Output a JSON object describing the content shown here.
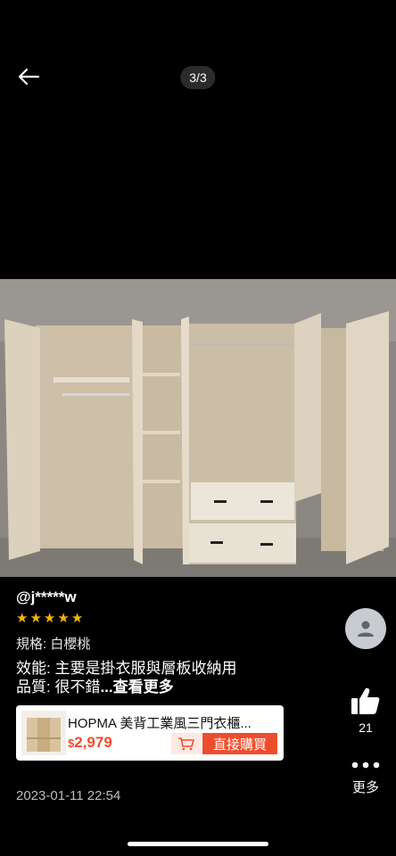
{
  "header": {
    "counter": "3/3"
  },
  "review": {
    "reviewer": "@j*****w",
    "rating": 5,
    "spec": "規格: 白櫻桃",
    "line1": "效能: 主要是掛衣服與層板收納用",
    "line2_prefix": "品質: 很不錯",
    "more_link": "...查看更多",
    "date": "2023-01-11 22:54"
  },
  "product": {
    "name": "HOPMA 美背工業風三門衣櫃...",
    "currency": "$",
    "price": "2,979",
    "buy_label": "直接購買"
  },
  "side": {
    "like_count": "21",
    "more_label": "更多"
  },
  "colors": {
    "accent": "#ee4d2d",
    "star": "#f5b400"
  }
}
